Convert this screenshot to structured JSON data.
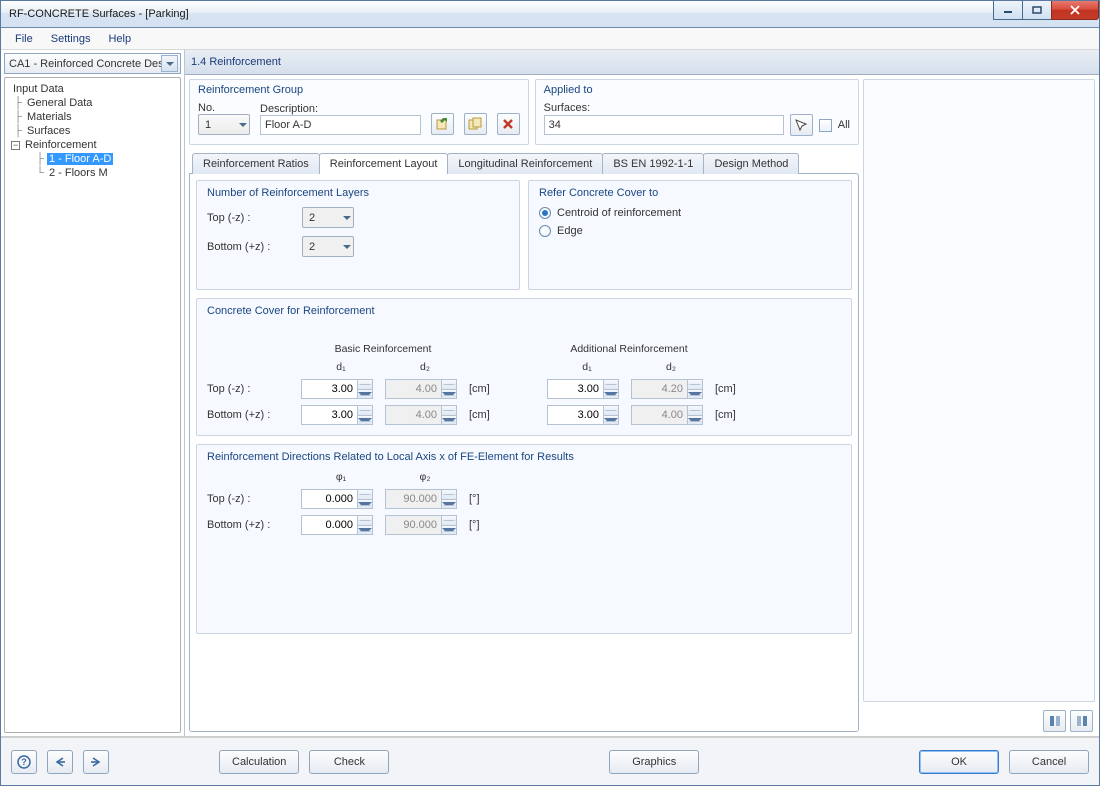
{
  "window": {
    "title": "RF-CONCRETE Surfaces - [Parking]"
  },
  "menu": {
    "file": "File",
    "settings": "Settings",
    "help": "Help"
  },
  "leftCombo": "CA1 - Reinforced Concrete Des",
  "tree": {
    "root": "Input Data",
    "n1": "General Data",
    "n2": "Materials",
    "n3": "Surfaces",
    "n4": "Reinforcement",
    "n4a": "1 - Floor A-D",
    "n4b": "2 - Floors M"
  },
  "pageTitle": "1.4 Reinforcement",
  "reinfGroup": {
    "legend": "Reinforcement Group",
    "noLabel": "No.",
    "noValue": "1",
    "descLabel": "Description:",
    "descValue": "Floor A-D"
  },
  "appliedTo": {
    "legend": "Applied to",
    "surfacesLabel": "Surfaces:",
    "surfacesValue": "34",
    "allLabel": "All"
  },
  "tabs": {
    "t1": "Reinforcement Ratios",
    "t2": "Reinforcement Layout",
    "t3": "Longitudinal Reinforcement",
    "t4": "BS EN 1992-1-1",
    "t5": "Design Method"
  },
  "layers": {
    "legend": "Number of Reinforcement Layers",
    "topLabel": "Top (-z) :",
    "topValue": "2",
    "botLabel": "Bottom (+z) :",
    "botValue": "2"
  },
  "coverRef": {
    "legend": "Refer Concrete Cover to",
    "opt1": "Centroid of reinforcement",
    "opt2": "Edge"
  },
  "cover": {
    "legend": "Concrete Cover for Reinforcement",
    "basic": "Basic Reinforcement",
    "add": "Additional Reinforcement",
    "d1": "d₁",
    "d2": "d₂",
    "top": "Top (-z) :",
    "bot": "Bottom (+z) :",
    "unit": "[cm]",
    "vals": {
      "b_top_d1": "3.00",
      "b_top_d2": "4.00",
      "b_bot_d1": "3.00",
      "b_bot_d2": "4.00",
      "a_top_d1": "3.00",
      "a_top_d2": "4.20",
      "a_bot_d1": "3.00",
      "a_bot_d2": "4.00"
    }
  },
  "dirs": {
    "legend": "Reinforcement Directions Related to Local Axis x of FE-Element for Results",
    "phi1": "φ₁",
    "phi2": "φ₂",
    "top": "Top (-z) :",
    "bot": "Bottom (+z) :",
    "unit": "[°]",
    "vals": {
      "top1": "0.000",
      "top2": "90.000",
      "bot1": "0.000",
      "bot2": "90.000"
    }
  },
  "footer": {
    "calculation": "Calculation",
    "check": "Check",
    "graphics": "Graphics",
    "ok": "OK",
    "cancel": "Cancel"
  }
}
